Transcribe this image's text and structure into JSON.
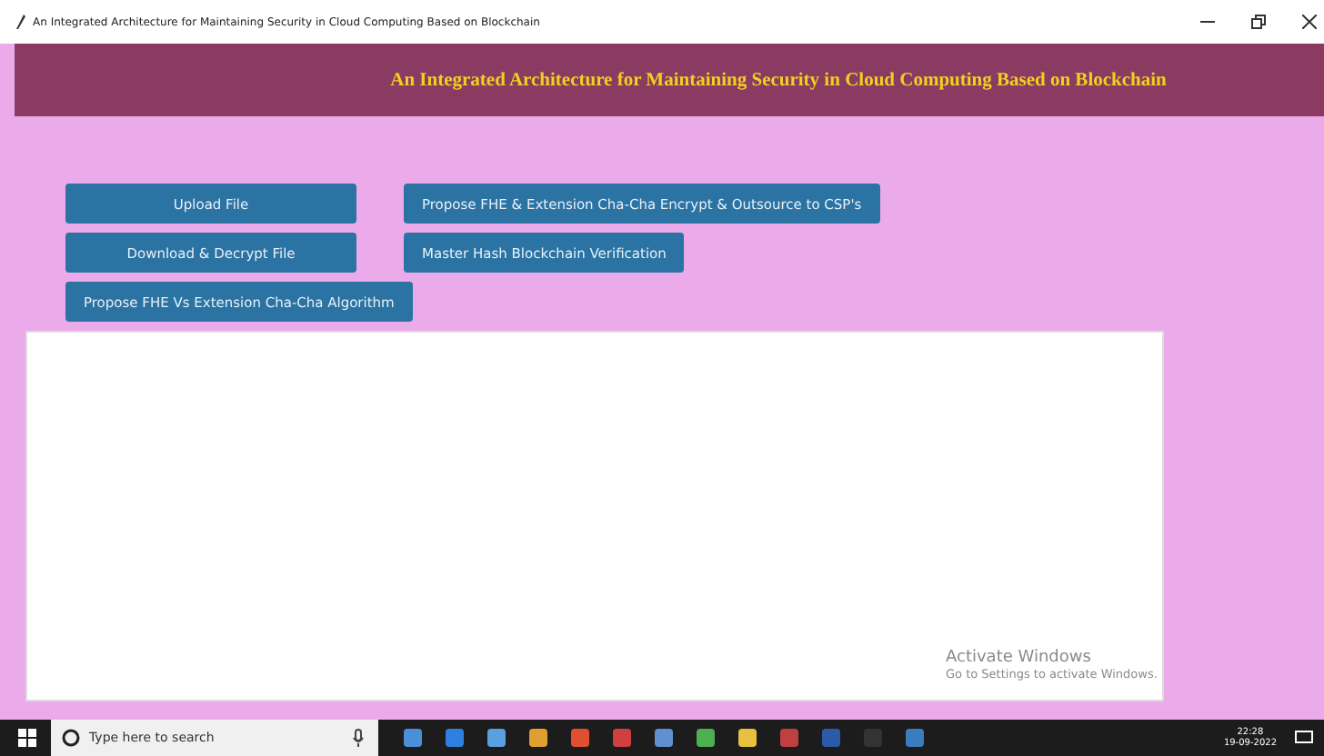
{
  "window": {
    "title": "An Integrated Architecture for Maintaining Security in Cloud Computing Based on Blockchain"
  },
  "header": {
    "title": "An Integrated Architecture for Maintaining Security in Cloud Computing Based on Blockchain"
  },
  "button_rows": [
    {
      "buttons": [
        {
          "label": "Upload File",
          "wide": true
        },
        {
          "label": "Propose FHE & Extension Cha-Cha Encrypt & Outsource to CSP's",
          "wide": false
        }
      ]
    },
    {
      "buttons": [
        {
          "label": "Download & Decrypt File",
          "wide": true
        },
        {
          "label": "Master Hash Blockchain Verification",
          "wide": false
        }
      ]
    },
    {
      "buttons": [
        {
          "label": "Propose FHE Vs Extension Cha-Cha Algorithm",
          "wide": false
        }
      ]
    }
  ],
  "activation": {
    "title": "Activate Windows",
    "subtitle": "Go to Settings to activate Windows."
  },
  "taskbar": {
    "search_placeholder": "Type here to search",
    "time": "22:28",
    "date": "19-09-2022"
  }
}
